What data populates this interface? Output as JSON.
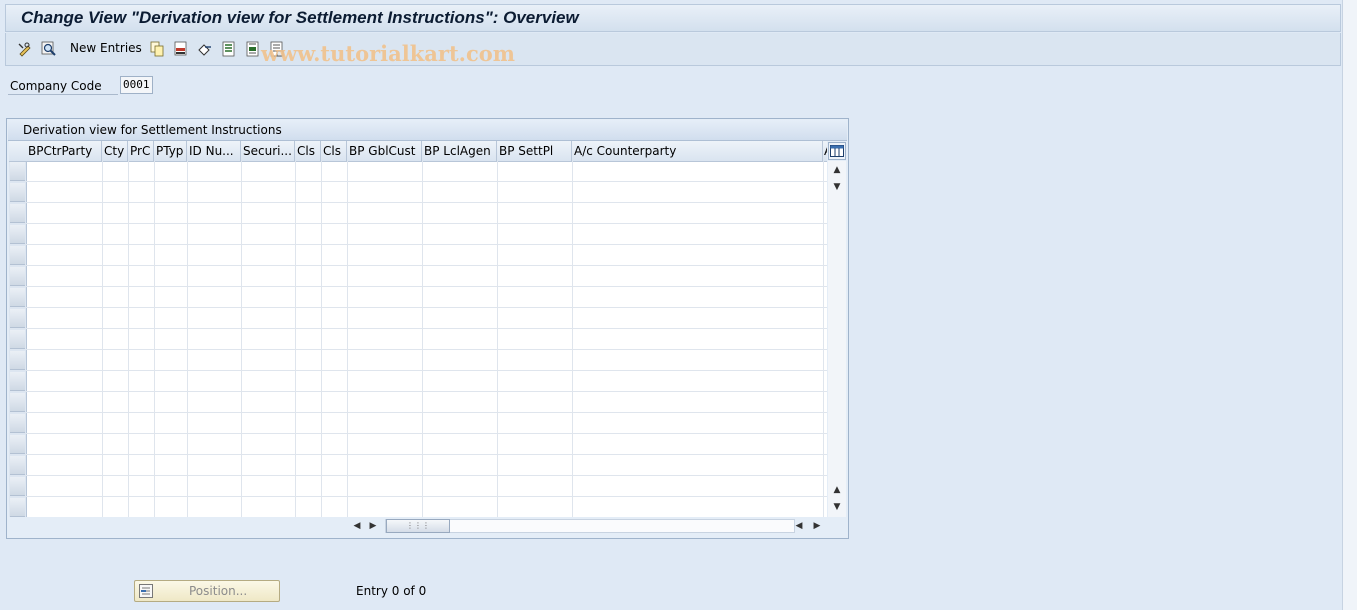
{
  "window": {
    "title": "Change View \"Derivation view for  Settlement Instructions\": Overview"
  },
  "toolbar": {
    "new_entries_label": "New Entries",
    "icons": [
      "change-display-icon",
      "find-icon",
      "copy-icon",
      "delete-icon",
      "undo-icon",
      "select-all-icon",
      "select-block-icon",
      "deselect-all-icon"
    ]
  },
  "watermark": "www.tutorialkart.com",
  "filter": {
    "company_code_label": "Company Code",
    "company_code_value": "0001"
  },
  "table": {
    "caption": "Derivation view for  Settlement Instructions",
    "columns": [
      "BPCtrParty",
      "Cty",
      "PrC",
      "PTyp",
      "ID Nu...",
      "Securi...",
      "Cls",
      "Cls",
      "BP GblCust",
      "BP LclAgen",
      "BP SettPl",
      "A/c Counterparty",
      "A"
    ],
    "rows": [],
    "empty_row_count": 17
  },
  "footer": {
    "position_button_label": "Position...",
    "entry_text": "Entry 0 of 0"
  },
  "colors": {
    "background": "#dfe9f5",
    "title_text": "#0c1c33",
    "watermark": "#f1c28d"
  }
}
